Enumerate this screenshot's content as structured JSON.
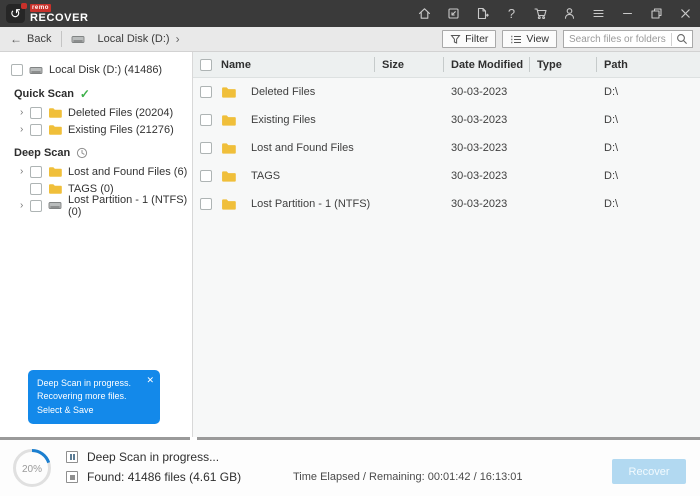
{
  "titlebar": {
    "brand_small": "remo",
    "brand_big": "RECOVER"
  },
  "navbar": {
    "back_label": "Back",
    "breadcrumb_label": "Local Disk (D:)",
    "filter_label": "Filter",
    "view_label": "View",
    "search_placeholder": "Search files or folders"
  },
  "sidebar": {
    "root_label": "Local Disk (D:) (41486)",
    "quick_scan_label": "Quick Scan",
    "deep_scan_label": "Deep Scan",
    "items": [
      {
        "label": "Deleted Files (20204)"
      },
      {
        "label": "Existing Files (21276)"
      },
      {
        "label": "Lost and Found Files (6)"
      },
      {
        "label": "TAGS (0)"
      },
      {
        "label": "Lost Partition - 1 (NTFS) (0)"
      }
    ],
    "toast": {
      "line1": "Deep Scan in progress.",
      "line2": "Recovering more files.",
      "line3": "Select & Save"
    }
  },
  "table": {
    "columns": {
      "name": "Name",
      "size": "Size",
      "date": "Date Modified",
      "type": "Type",
      "path": "Path"
    },
    "rows": [
      {
        "name": "Deleted Files",
        "size": "",
        "date": "30-03-2023",
        "type": "",
        "path": "D:\\"
      },
      {
        "name": "Existing Files",
        "size": "",
        "date": "30-03-2023",
        "type": "",
        "path": "D:\\"
      },
      {
        "name": "Lost and Found Files",
        "size": "",
        "date": "30-03-2023",
        "type": "",
        "path": "D:\\"
      },
      {
        "name": "TAGS",
        "size": "",
        "date": "30-03-2023",
        "type": "",
        "path": "D:\\"
      },
      {
        "name": "Lost Partition - 1 (NTFS)",
        "size": "",
        "date": "30-03-2023",
        "type": "",
        "path": "D:\\"
      }
    ]
  },
  "statusbar": {
    "progress_label": "20%",
    "progress_value": 20,
    "scan_status": "Deep Scan in progress...",
    "found_status": "Found: 41486 files (4.61 GB)",
    "time_label": "Time Elapsed / Remaining: 00:01:42 / 16:13:01",
    "recover_label": "Recover"
  },
  "icons": {
    "brand_arrow": "↺",
    "back": "←",
    "breadcrumb_chevron": "›",
    "expand_chevron": "›",
    "check": "✓",
    "help": "?",
    "toast_close": "✕"
  },
  "colors": {
    "titlebar_bg": "#3a3a3a",
    "brand_red": "#c8312b",
    "toast_blue": "#1389ea",
    "progress_blue": "#1b7fd0",
    "folder_yellow": "#f0bf3a",
    "success_green": "#3db049",
    "recover_disabled_bg": "#b2d9f1"
  }
}
